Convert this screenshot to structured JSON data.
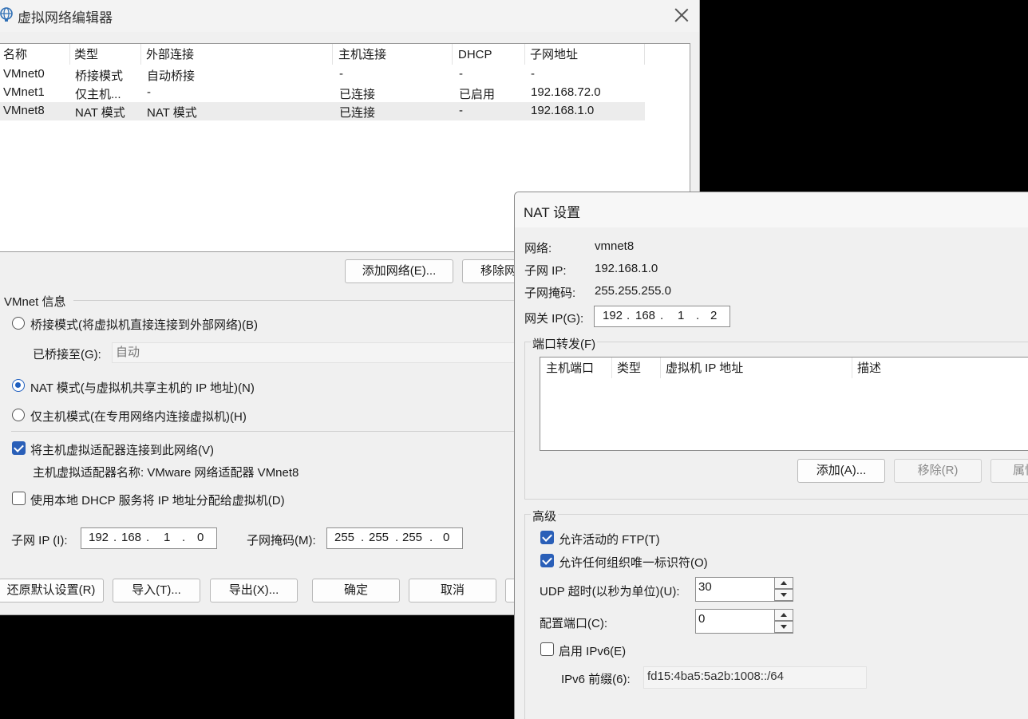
{
  "main_window": {
    "title": "虚拟网络编辑器",
    "columns": [
      "名称",
      "类型",
      "外部连接",
      "主机连接",
      "DHCP",
      "子网地址"
    ],
    "rows": [
      [
        "VMnet0",
        "桥接模式",
        "自动桥接",
        "-",
        "-",
        "-"
      ],
      [
        "VMnet1",
        "仅主机...",
        "-",
        "已连接",
        "已启用",
        "192.168.72.0"
      ],
      [
        "VMnet8",
        "NAT 模式",
        "NAT 模式",
        "已连接",
        "-",
        "192.168.1.0"
      ]
    ],
    "add_network_label": "添加网络(E)...",
    "remove_network_label": "移除网",
    "vmnet_info_label": "VMnet 信息",
    "bridge_mode_label": "桥接模式(将虚拟机直接连接到外部网络)(B)",
    "bridged_to_label": "已桥接至(G):",
    "bridged_to_value": "自动",
    "nat_mode_label": "NAT 模式(与虚拟机共享主机的 IP 地址)(N)",
    "host_only_label": "仅主机模式(在专用网络内连接虚拟机)(H)",
    "connect_adapter_label": "将主机虚拟适配器连接到此网络(V)",
    "adapter_name_label": "主机虚拟适配器名称: VMware 网络适配器 VMnet8",
    "use_dhcp_label": "使用本地 DHCP 服务将 IP 地址分配给虚拟机(D)",
    "subnet_ip_label": "子网 IP (I):",
    "subnet_ip": [
      "192",
      "168",
      "1",
      "0"
    ],
    "subnet_mask_label": "子网掩码(M):",
    "subnet_mask": [
      "255",
      "255",
      "255",
      "0"
    ],
    "restore_defaults_label": "还原默认设置(R)",
    "import_label": "导入(T)...",
    "export_label": "导出(X)...",
    "ok_label": "确定",
    "cancel_label": "取消",
    "selected_mode": "nat",
    "connect_adapter_checked": true,
    "use_dhcp_checked": false
  },
  "nat_window": {
    "title": "NAT 设置",
    "network_label": "网络:",
    "network_value": "vmnet8",
    "subnet_ip_label": "子网 IP:",
    "subnet_ip_value": "192.168.1.0",
    "subnet_mask_label": "子网掩码:",
    "subnet_mask_value": "255.255.255.0",
    "gateway_label": "网关 IP(G):",
    "gateway_ip": [
      "192",
      "168",
      "1",
      "2"
    ],
    "port_forwarding_label": "端口转发(F)",
    "pf_columns": [
      "主机端口",
      "类型",
      "虚拟机 IP 地址",
      "描述"
    ],
    "add_label": "添加(A)...",
    "remove_label": "移除(R)",
    "properties_label": "属性",
    "advanced_label": "高级",
    "allow_ftp_label": "允许活动的 FTP(T)",
    "allow_ftp_checked": true,
    "allow_oui_label": "允许任何组织唯一标识符(O)",
    "allow_oui_checked": true,
    "udp_timeout_label": "UDP 超时(以秒为单位)(U):",
    "udp_timeout_value": "30",
    "config_port_label": "配置端口(C):",
    "config_port_value": "0",
    "enable_ipv6_label": "启用 IPv6(E)",
    "enable_ipv6_checked": false,
    "ipv6_prefix_label": "IPv6 前缀(6):",
    "ipv6_prefix_value": "fd15:4ba5:5a2b:1008::/64"
  }
}
